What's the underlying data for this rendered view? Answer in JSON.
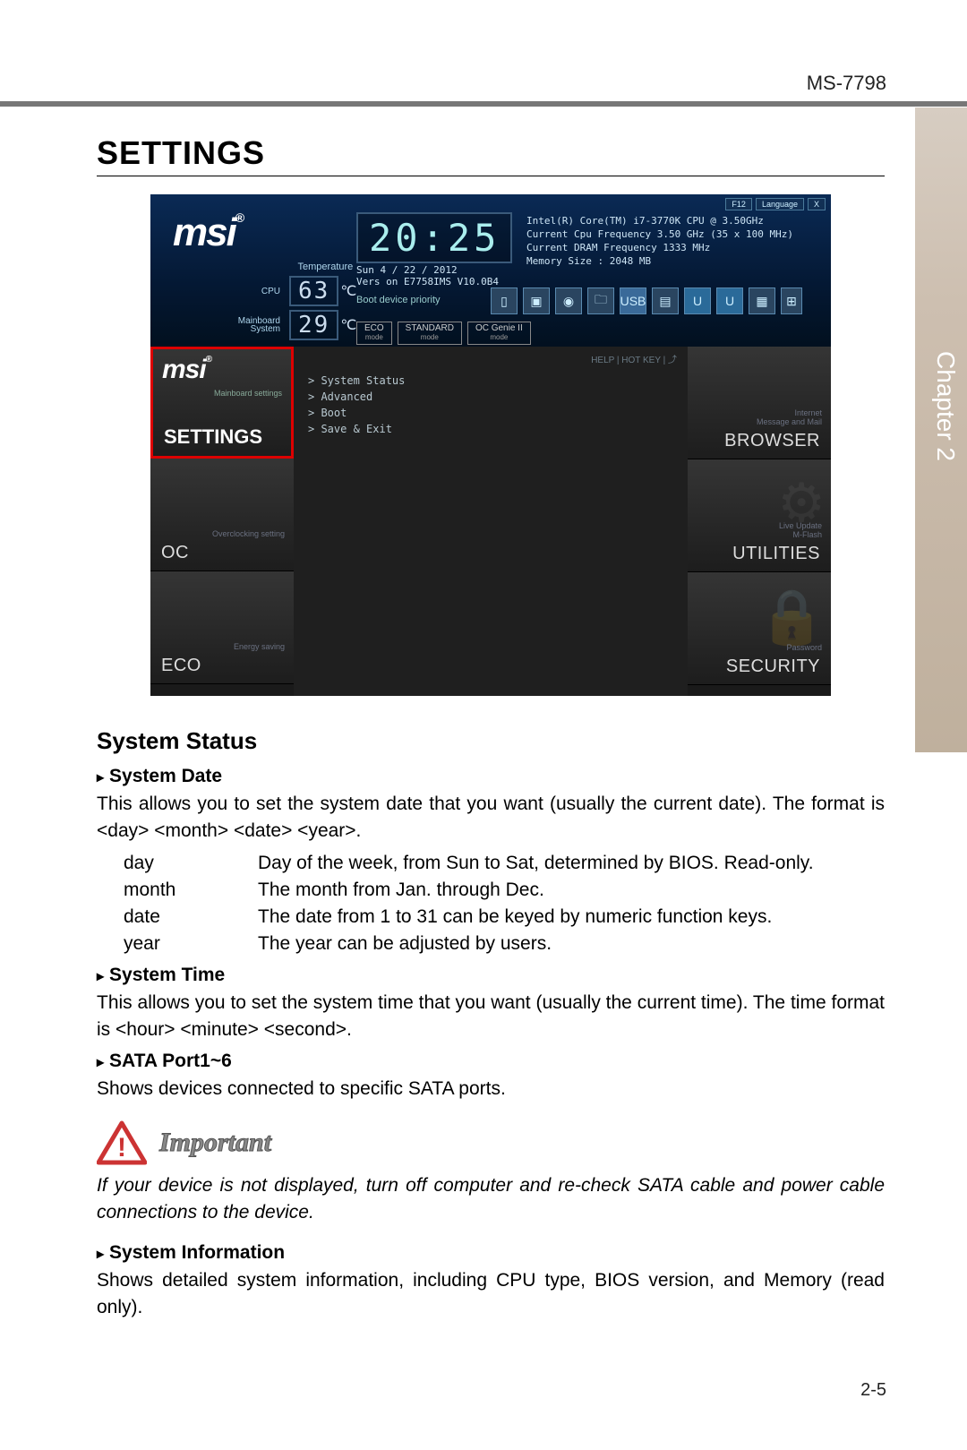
{
  "header": {
    "model": "MS-7798"
  },
  "chapter": {
    "label": "Chapter 2"
  },
  "title": "SETTINGS",
  "bios": {
    "logo": "msi",
    "clock": "20:25",
    "info_lines": [
      "Intel(R) Core(TM) i7-3770K CPU @ 3.50GHz",
      "Current Cpu Frequency 3.50 GHz (35 x 100 MHz)",
      "Current DRAM Frequency 1333 MHz",
      "Memory Size : 2048 MB"
    ],
    "date_line": "Sun  4 / 22 / 2012",
    "version_line": "Vers on E7758IMS V10.0B4",
    "temperature_label": "Temperature",
    "temps": {
      "cpu_label": "CPU",
      "cpu_value": "63",
      "mb_label": "Mainboard\nSystem",
      "mb_value": "29",
      "unit": "℃"
    },
    "boot_label": "Boot device priority",
    "top_right": {
      "f12": "F12",
      "language": "Language",
      "close": "X"
    },
    "modes": [
      {
        "main": "ECO",
        "sub": "mode"
      },
      {
        "main": "STANDARD",
        "sub": "mode"
      },
      {
        "main": "OC Genie II",
        "sub": "mode"
      }
    ],
    "help_hotkey": "HELP | HOT KEY | ⤴",
    "menu": [
      "> System Status",
      "> Advanced",
      "> Boot",
      "> Save & Exit"
    ],
    "tiles_left": [
      {
        "name": "settings",
        "label": "SETTINGS",
        "sub": "Mainboard settings"
      },
      {
        "name": "oc",
        "label": "OC",
        "sub": "Overclocking setting"
      },
      {
        "name": "eco",
        "label": "ECO",
        "sub": "Energy saving"
      }
    ],
    "tiles_right": [
      {
        "name": "browser",
        "label": "BROWSER",
        "sub": "Internet\nMessage and Mail"
      },
      {
        "name": "utilities",
        "label": "UTILITIES",
        "sub": "Live Update\nM-Flash"
      },
      {
        "name": "security",
        "label": "SECURITY",
        "sub": "Password"
      }
    ]
  },
  "sections": {
    "system_status": {
      "heading": "System Status",
      "system_date": {
        "head": "System Date",
        "p1": "This allows you to set the system date that you want (usually the current date). The format is <day> <month> <date> <year>.",
        "rows": [
          {
            "k": "day",
            "v": "Day of the week, from Sun to Sat, determined by BIOS. Read-only."
          },
          {
            "k": "month",
            "v": "The month from Jan. through Dec."
          },
          {
            "k": "date",
            "v": "The date from 1 to 31 can be keyed by numeric function keys."
          },
          {
            "k": "year",
            "v": "The year can be adjusted by users."
          }
        ]
      },
      "system_time": {
        "head": "System Time",
        "p": "This allows you to set the system time that you want (usually the current time). The time format is <hour> <minute> <second>."
      },
      "sata": {
        "head": "SATA Port1~6",
        "p": "Shows devices connected to specific SATA ports."
      },
      "important": {
        "label": "Important",
        "p": "If your device is not displayed, turn off computer and re-check SATA cable and power cable connections to the device."
      },
      "sysinfo": {
        "head": "System Information",
        "p": "Shows detailed system information, including CPU type, BIOS version, and Memory (read only)."
      }
    }
  },
  "footer": {
    "page": "2-5"
  }
}
